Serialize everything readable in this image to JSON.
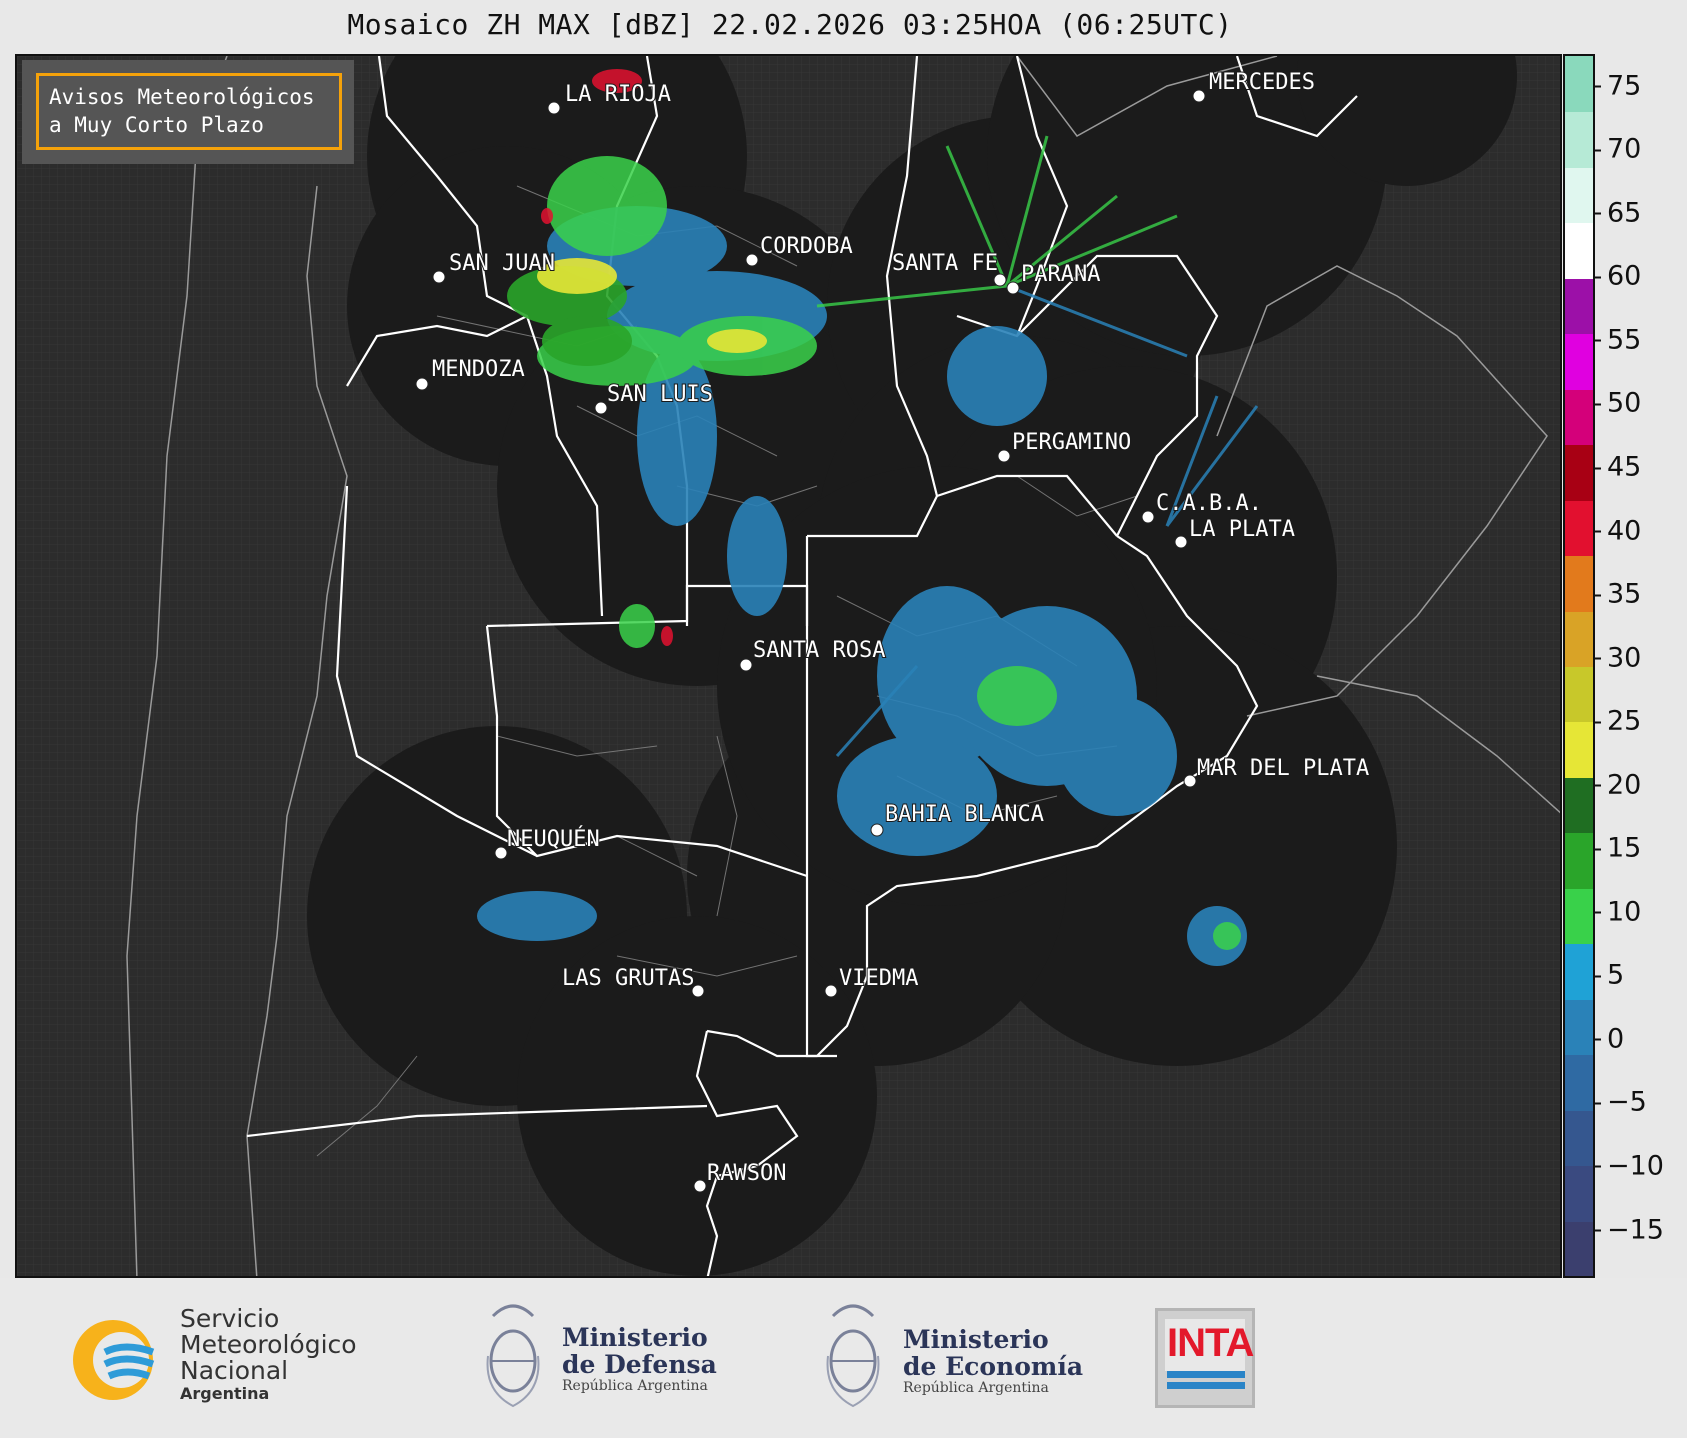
{
  "title": "Mosaico ZH MAX [dBZ] 22.02.2026 03:25HOA (06:25UTC)",
  "alert_box": {
    "line1": "Avisos Meteorológicos",
    "line2": "a Muy Corto Plazo"
  },
  "cities": [
    {
      "name": "LA RIOJA"
    },
    {
      "name": "MERCEDES"
    },
    {
      "name": "SAN JUAN"
    },
    {
      "name": "CORDOBA"
    },
    {
      "name": "SANTA FE"
    },
    {
      "name": "PARANA"
    },
    {
      "name": "MENDOZA"
    },
    {
      "name": "SAN LUIS"
    },
    {
      "name": "PERGAMINO"
    },
    {
      "name": "C.A.B.A."
    },
    {
      "name": "LA PLATA"
    },
    {
      "name": "SANTA ROSA"
    },
    {
      "name": "MAR DEL PLATA"
    },
    {
      "name": "BAHIA BLANCA"
    },
    {
      "name": "NEUQUÉN"
    },
    {
      "name": "LAS GRUTAS"
    },
    {
      "name": "VIEDMA"
    },
    {
      "name": "RAWSON"
    }
  ],
  "colorbar": {
    "unit": "dBZ",
    "ticks": [
      "75",
      "70",
      "65",
      "60",
      "55",
      "50",
      "45",
      "40",
      "35",
      "30",
      "25",
      "20",
      "15",
      "10",
      "5",
      "0",
      "−5",
      "−10",
      "−15"
    ],
    "range": [
      -18.5,
      77.5
    ],
    "colors_low_to_high": [
      "#3b3f6e",
      "#3a4a80",
      "#35578f",
      "#2f6aa3",
      "#2a82b8",
      "#1fa2d6",
      "#39d14a",
      "#2aa52a",
      "#1f6e22",
      "#e6e636",
      "#c8c82a",
      "#d9a326",
      "#e27a1c",
      "#e2102f",
      "#a80014",
      "#d4007a",
      "#e000e0",
      "#9c10a8",
      "#ffffff",
      "#e0f7ef",
      "#b6ead6",
      "#8ad9bc"
    ]
  },
  "footer": {
    "smn": {
      "line1": "Servicio",
      "line2": "Meteorológico",
      "line3": "Nacional",
      "line4": "Argentina"
    },
    "defensa": {
      "line1": "Ministerio",
      "line2": "de Defensa",
      "line3": "República Argentina"
    },
    "economia": {
      "line1": "Ministerio",
      "line2": "de Economía",
      "line3": "República Argentina"
    },
    "inta": {
      "label": "INTA"
    }
  }
}
